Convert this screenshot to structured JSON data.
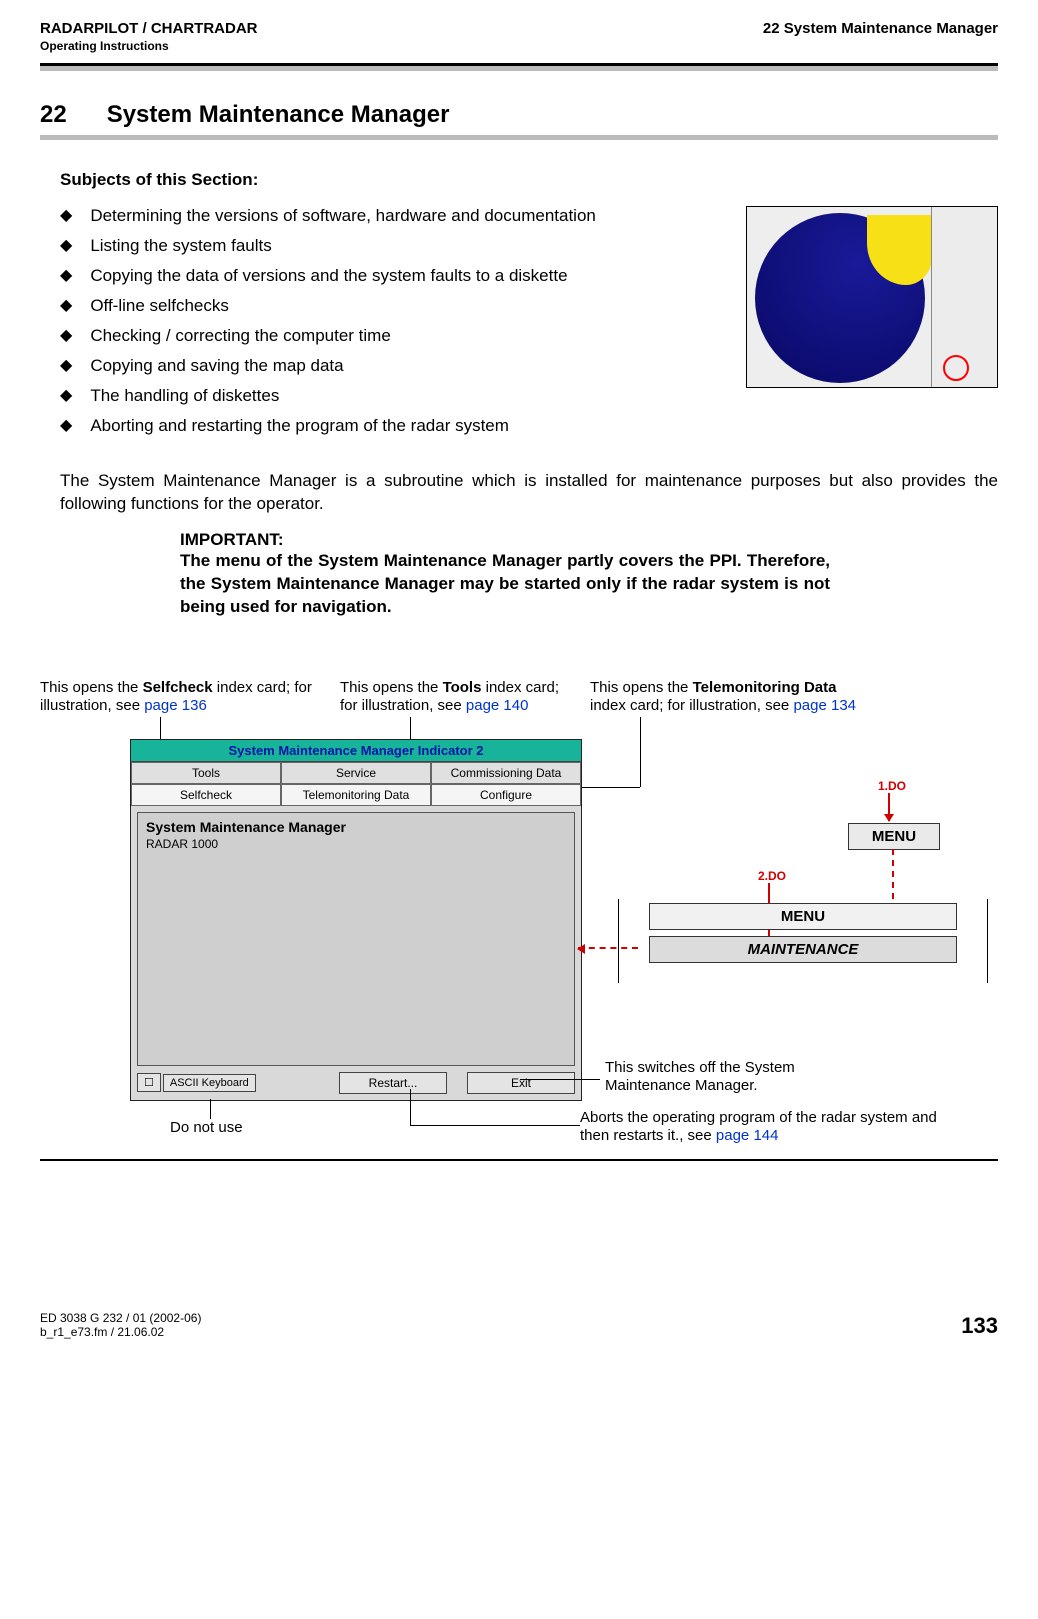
{
  "header": {
    "left_title": "RADARPILOT / CHARTRADAR",
    "left_sub": "Operating Instructions",
    "right_title": "22  System Maintenance Manager"
  },
  "chapter": {
    "number": "22",
    "title": "System Maintenance Manager"
  },
  "subjects_heading": "Subjects of this Section:",
  "subjects": [
    "Determining the versions of software, hardware and documentation",
    "Listing the system faults",
    "Copying the data of versions and the system faults to a diskette",
    "Off-line selfchecks",
    "Checking / correcting the computer time",
    "Copying and saving the map data",
    "The handling of diskettes",
    "Aborting and restarting the program of the radar system"
  ],
  "intro_para": "The System Maintenance Manager is a subroutine which is installed for maintenance purposes but also provides the following functions for the operator.",
  "important": {
    "title": "IMPORTANT:",
    "body": "The menu of the System Maintenance Manager partly covers the PPI. Therefore, the System Maintenance Manager may be started only if the radar system is not being used for navigation."
  },
  "annotations": {
    "selfcheck_a": "This opens the ",
    "selfcheck_b": "Selfcheck",
    "selfcheck_c": " index card; for illustration, see ",
    "selfcheck_page": "page 136",
    "tools_a": "This opens the ",
    "tools_b": "Tools",
    "tools_c": " index card; for illustration, see ",
    "tools_page": "page 140",
    "tele_a": "This opens the ",
    "tele_b": "Telemonitoring Data",
    "tele_c": " index card; for illustration, see ",
    "tele_page": "page 134",
    "do_not_use": "Do not use",
    "switch_off": "This switches off the System Maintenance Manager.",
    "restart_a": "Aborts the operating program of the radar system and then restarts it., see ",
    "restart_page": "page 144"
  },
  "window": {
    "title": "System Maintenance Manager Indicator 2",
    "tabs_top": [
      "Tools",
      "Service",
      "Commissioning Data"
    ],
    "tabs_bottom": [
      "Selfcheck",
      "Telemonitoring Data",
      "Configure"
    ],
    "inner_title": "System Maintenance Manager",
    "inner_sub": "RADAR 1000",
    "btn_ascii": "ASCII Keyboard",
    "btn_restart": "Restart...",
    "btn_exit": "Exit"
  },
  "menu_diagram": {
    "step1": "1.DO",
    "step2": "2.DO",
    "menu_btn": "MENU",
    "menu_bar": "MENU",
    "maintenance": "MAINTENANCE"
  },
  "footer": {
    "left1": "ED 3038 G 232 / 01 (2002-06)",
    "left2": "b_r1_e73.fm / 21.06.02",
    "page": "133"
  }
}
